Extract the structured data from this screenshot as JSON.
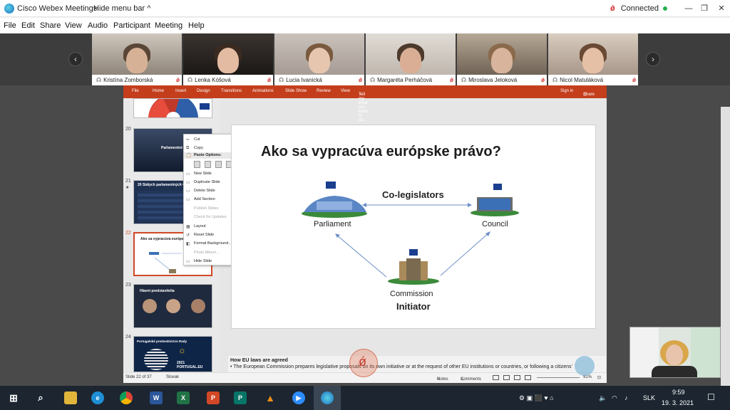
{
  "window": {
    "app_title": "Cisco Webex Meetings",
    "hide_menu_label": "Hide menu bar",
    "status": "Connected",
    "mute_glyph": "ǿ",
    "minimize": "—",
    "maximize": "❐",
    "close": "✕"
  },
  "menu": [
    "File",
    "Edit",
    "Share",
    "View",
    "Audio",
    "Participant",
    "Meeting",
    "Help"
  ],
  "participants": [
    {
      "name": "Kristína Zomborská"
    },
    {
      "name": "Lenka Kóšová"
    },
    {
      "name": "Lucia Ivanická"
    },
    {
      "name": "Margaréta Perháčová"
    },
    {
      "name": "Miroslava Jeloková"
    },
    {
      "name": "Nicol Matuláková"
    }
  ],
  "ribbon": {
    "tabs": [
      "File",
      "Home",
      "Insert",
      "Design",
      "Transitions",
      "Animations",
      "Slide Show",
      "Review",
      "View"
    ],
    "tell_me": "Tell me what you want to do...",
    "sign_in": "Sign in",
    "share": "Share"
  },
  "thumbnails": [
    {
      "num": "20",
      "title": "Parlamentné výbory"
    },
    {
      "num": "21",
      "title": "20 Stálych parlamentných výborov"
    },
    {
      "num": "22",
      "title": "Ako sa vypracúva európs..."
    },
    {
      "num": "23",
      "title": "Hlavní predstavitelia"
    },
    {
      "num": "24",
      "title": "Portugalské predsedníctvo Rady"
    }
  ],
  "context_menu": {
    "items": [
      {
        "label": "Cut",
        "disabled": false
      },
      {
        "label": "Copy",
        "disabled": false
      },
      {
        "label": "Paste Options:",
        "disabled": false,
        "header": true
      },
      {
        "label": "New Slide",
        "disabled": false
      },
      {
        "label": "Duplicate Slide",
        "disabled": false
      },
      {
        "label": "Delete Slide",
        "disabled": false
      },
      {
        "label": "Add Section",
        "disabled": false
      },
      {
        "label": "Publish Slides",
        "disabled": true
      },
      {
        "label": "Check for Updates",
        "disabled": true
      },
      {
        "label": "Layout",
        "disabled": false
      },
      {
        "label": "Reset Slide",
        "disabled": false
      },
      {
        "label": "Format Background...",
        "disabled": false
      },
      {
        "label": "Photo Album...",
        "disabled": true
      },
      {
        "label": "Hide Slide",
        "disabled": false
      }
    ]
  },
  "slide": {
    "title": "Ako sa vypracúva európske právo?",
    "co_legislators": "Co-legislators",
    "parliament": "Parliament",
    "council": "Council",
    "commission": "Commission",
    "initiator": "Initiator"
  },
  "notes": {
    "heading": "How EU laws are agreed",
    "body": "•   The European Commission prepares legislative proposals on its own initiative or at the request of other EU institutions or countries, or following a citizens'"
  },
  "statusbar": {
    "slide_info": "Slide 22 of 37",
    "language": "Slovak",
    "notes": "Notes",
    "comments": "Comments",
    "zoom": "91%"
  },
  "taskbar": {
    "language": "SLK",
    "time": "9:59",
    "date": "19. 3. 2021"
  },
  "colors": {
    "ppt_accent": "#c43e1c",
    "webex_connected": "#22b14c",
    "mute_red": "#d3302f"
  }
}
